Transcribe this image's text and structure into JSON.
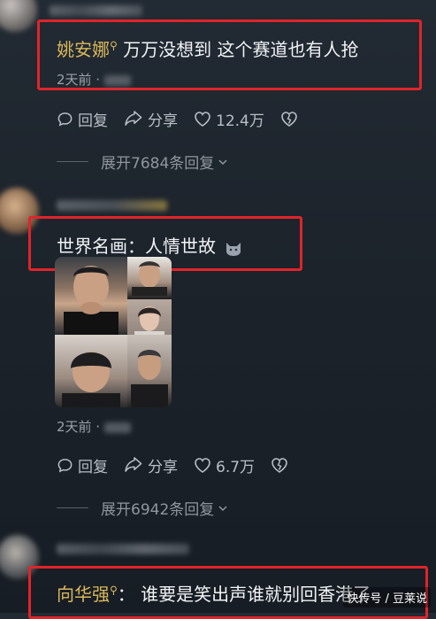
{
  "comments": [
    {
      "username": "姚安娜",
      "text": "万万没想到 这个赛道也有人抢",
      "time": "2天前 · ",
      "reply_label": "回复",
      "share_label": "分享",
      "likes": "12.4万",
      "expand_label": "展开7684条回复"
    },
    {
      "text": "世界名画：人情世故",
      "time": "2天前 · ",
      "reply_label": "回复",
      "share_label": "分享",
      "likes": "6.7万",
      "expand_label": "展开6942条回复"
    },
    {
      "username": "向华强",
      "separator": "：",
      "text": "谁要是笑出声谁就别回香港了"
    }
  ],
  "watermark": "快传号 / 豆莱说",
  "colors": {
    "background": "#1c232b",
    "highlight": "#e0242a",
    "username": "#d9b85c",
    "meta": "#9aa1a9"
  },
  "icons": {
    "reply": "chat-bubble-icon",
    "share": "share-arrow-icon",
    "like": "heart-icon",
    "dislike": "broken-heart-icon",
    "expand": "chevron-down-icon",
    "verified": "search-badge-icon",
    "emoji": "cat-emoji-icon"
  }
}
